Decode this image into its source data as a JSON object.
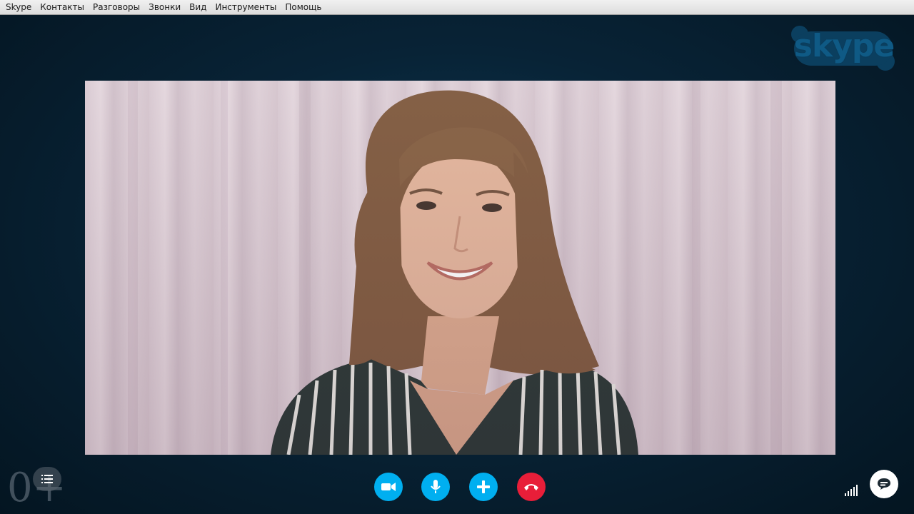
{
  "menu": {
    "items": [
      "Skype",
      "Контакты",
      "Разговоры",
      "Звонки",
      "Вид",
      "Инструменты",
      "Помощь"
    ]
  },
  "brand": {
    "logo_text": "skype",
    "accent_color": "#00aff0",
    "hangup_color": "#e81e39"
  },
  "call": {
    "participant_count_label": "0+",
    "signal_icon": "signal-strength-icon",
    "controls": [
      {
        "name": "video-toggle",
        "icon": "video-camera-icon"
      },
      {
        "name": "mic-toggle",
        "icon": "microphone-icon"
      },
      {
        "name": "add-to-call",
        "icon": "plus-icon"
      },
      {
        "name": "hang-up",
        "icon": "phone-hangup-icon"
      }
    ]
  }
}
